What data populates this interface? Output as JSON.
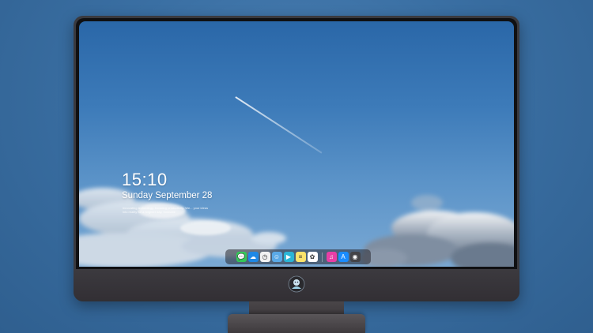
{
  "lockscreen": {
    "time": "15:10",
    "date": "Sunday September 28",
    "tagline": "Innovating technology, boosting productivity. We... your ideas into reality for a brighter day. Innovate"
  },
  "dock": {
    "items": [
      {
        "name": "messages-icon",
        "color": "#35c759",
        "glyph": "💬"
      },
      {
        "name": "weather-icon",
        "color": "#1e88e5",
        "glyph": "☁"
      },
      {
        "name": "clock-icon",
        "color": "#f2f2f2",
        "glyph": "◷"
      },
      {
        "name": "finder-icon",
        "color": "#5aa9e6",
        "glyph": "☺"
      },
      {
        "name": "video-icon",
        "color": "#2bb5d6",
        "glyph": "▶"
      },
      {
        "name": "notes-icon",
        "color": "#fbe36b",
        "glyph": "≡"
      },
      {
        "name": "photos-icon",
        "color": "#ffffff",
        "glyph": "✿"
      },
      {
        "name": "music-icon",
        "color": "#e83ea6",
        "glyph": "♫"
      },
      {
        "name": "appstore-icon",
        "color": "#1a8cff",
        "glyph": "A"
      },
      {
        "name": "camera-icon",
        "color": "#444448",
        "glyph": "◉"
      }
    ]
  },
  "colors": {
    "screen_top": "#2a67a8",
    "bezel": "#101012",
    "chin": "#3c3a3f"
  }
}
